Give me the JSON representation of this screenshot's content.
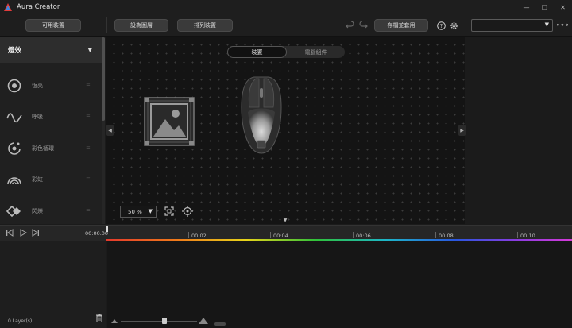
{
  "window": {
    "title": "Aura Creator"
  },
  "toolbar": {
    "available_devices": "可用裝置",
    "set_as_layer": "設為圖層",
    "arrange_devices": "排列裝置",
    "save_apply": "存檔並套用",
    "profile_selected": ""
  },
  "effects_panel": {
    "title": "燈效",
    "items": [
      {
        "label": "恆亮",
        "icon": "static-icon"
      },
      {
        "label": "呼吸",
        "icon": "breathing-icon"
      },
      {
        "label": "彩色循環",
        "icon": "color-cycle-icon"
      },
      {
        "label": "彩虹",
        "icon": "rainbow-icon"
      },
      {
        "label": "閃爍",
        "icon": "strobe-icon"
      }
    ]
  },
  "canvas": {
    "tabs": [
      "裝置",
      "電腦組件"
    ],
    "active_tab": 0,
    "zoom": "50 %"
  },
  "timeline": {
    "current_time": "00:00.00",
    "ticks": [
      "00:02",
      "00:04",
      "00:06",
      "00:08",
      "00:10"
    ],
    "layers_count": "0 Layer(s)"
  },
  "colors": {
    "accent_button": "#3a3a3a",
    "background": "#1b1b1b"
  }
}
